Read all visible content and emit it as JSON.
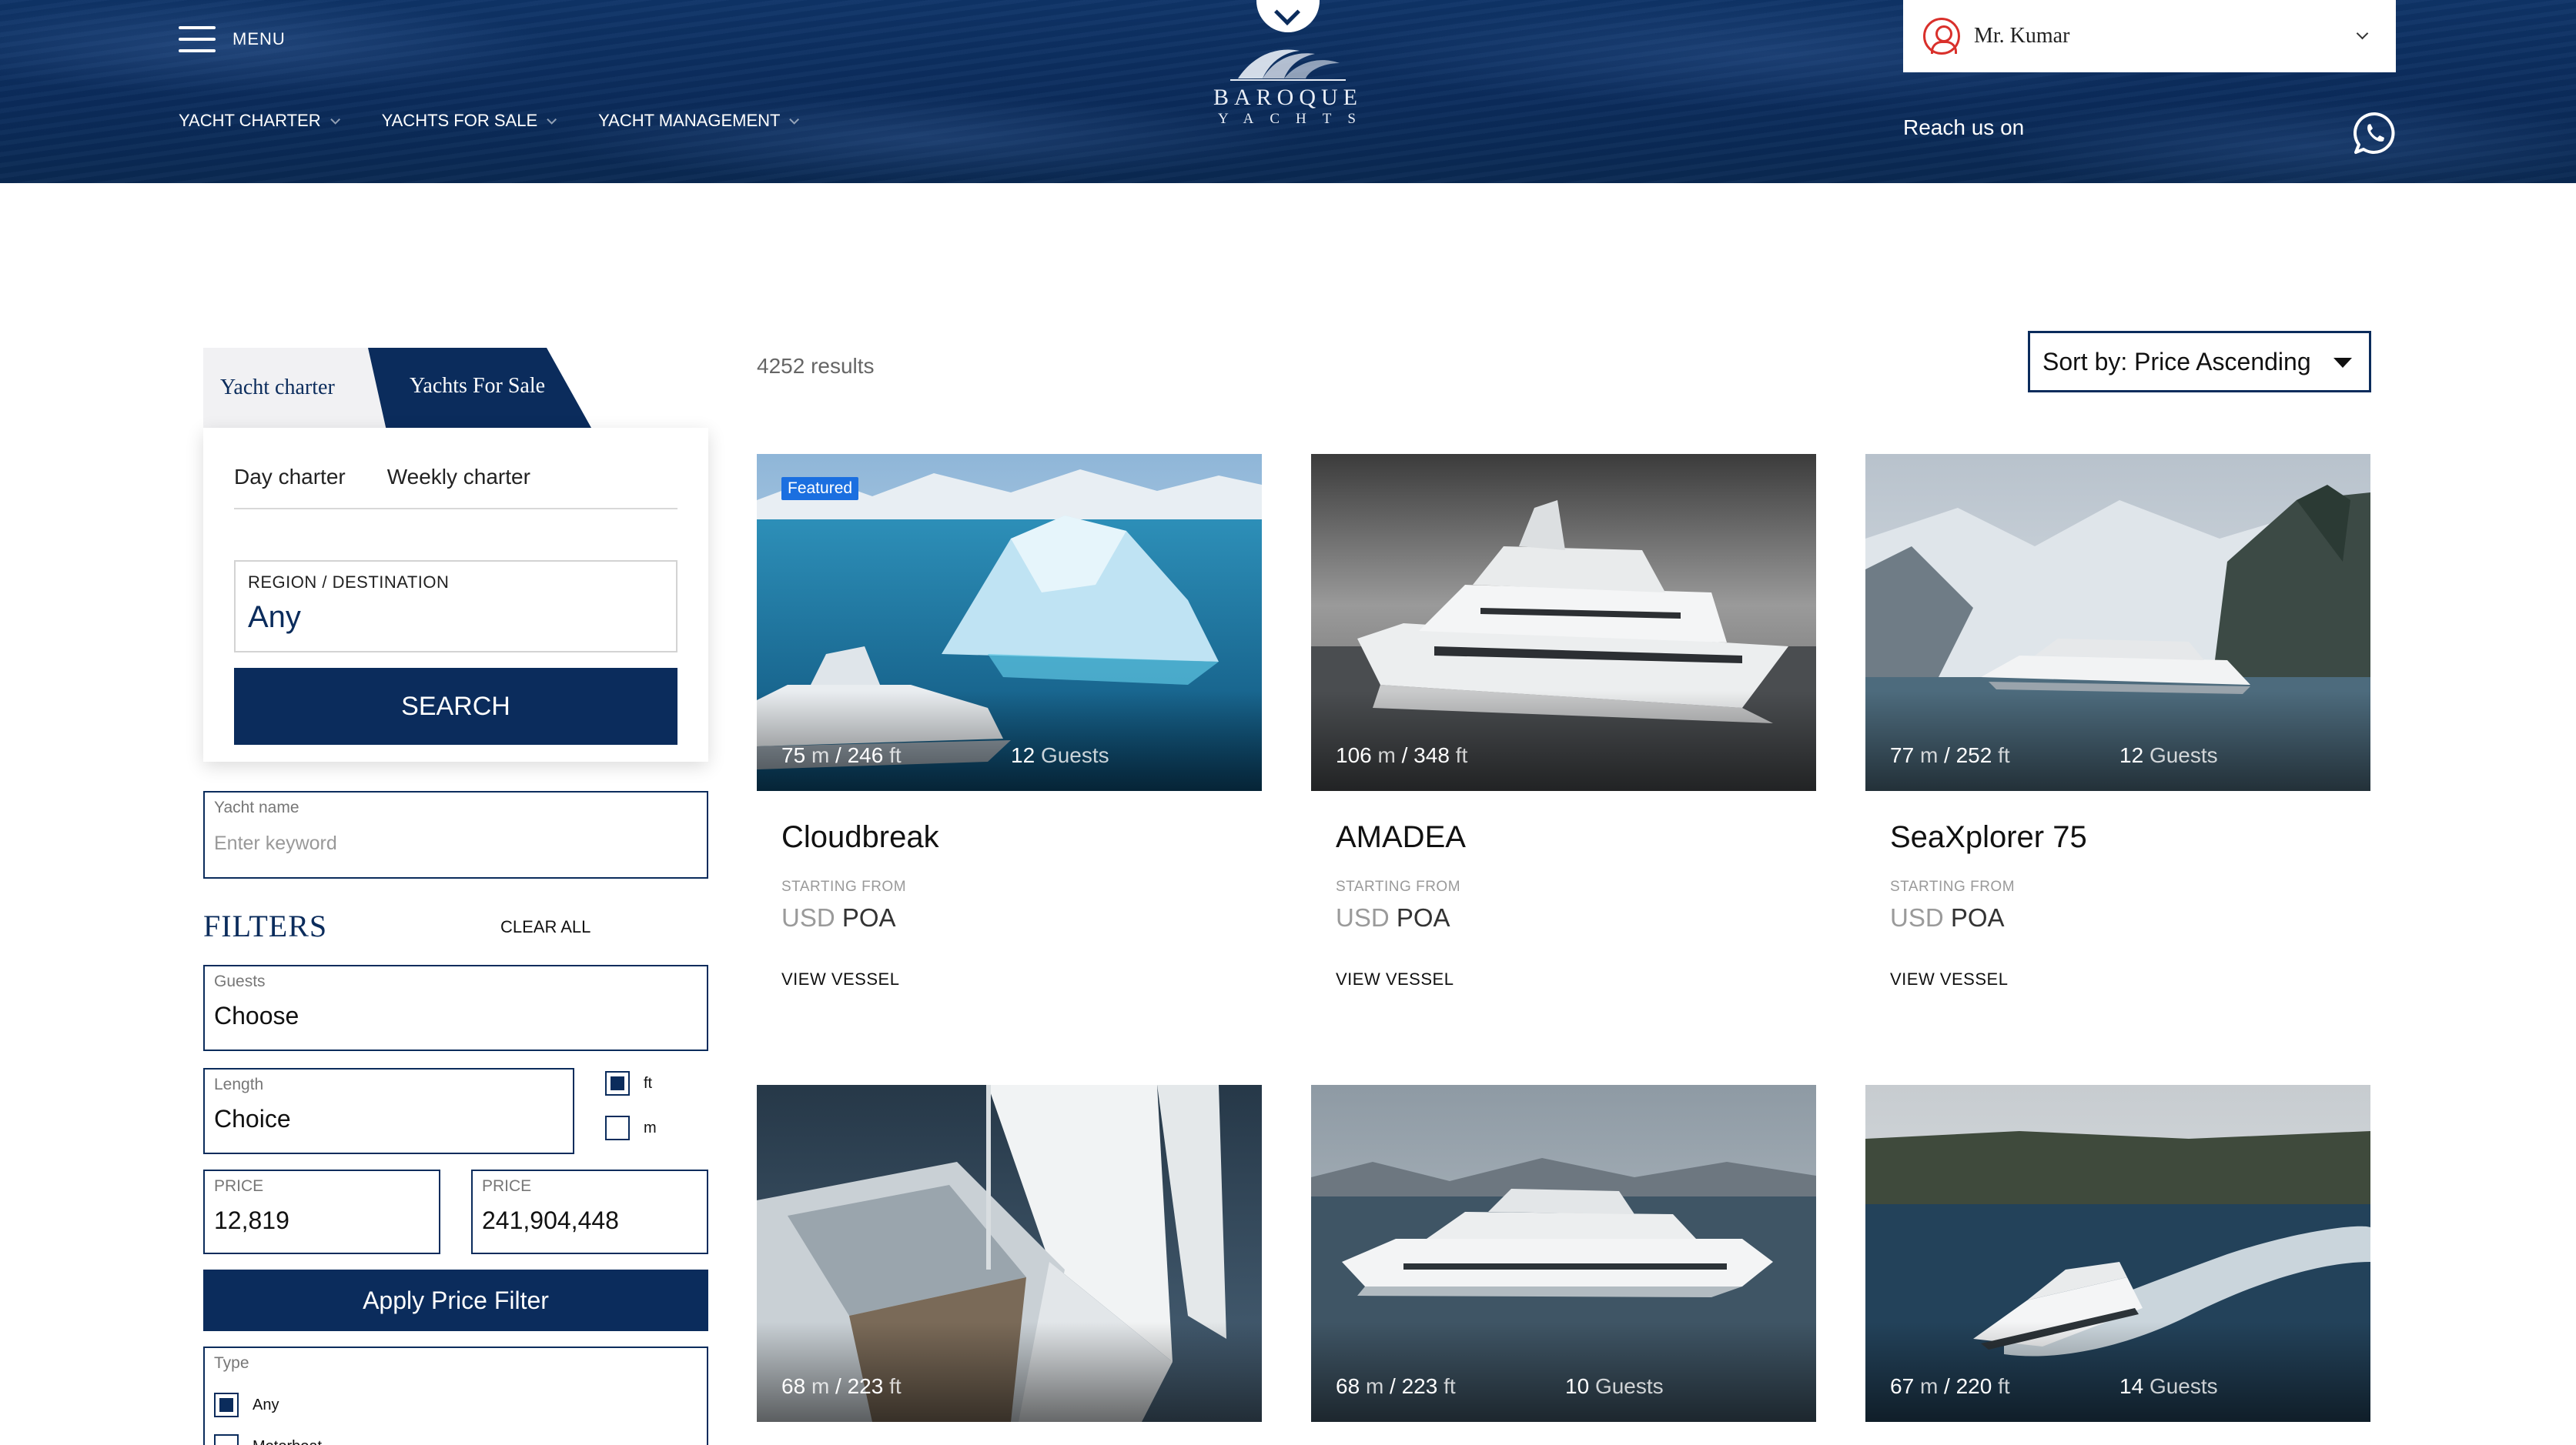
{
  "header": {
    "menu_label": "MENU",
    "nav": [
      {
        "label": "YACHT CHARTER"
      },
      {
        "label": "YACHTS FOR SALE"
      },
      {
        "label": "YACHT MANAGEMENT"
      }
    ],
    "logo": {
      "name": "BAROQUE",
      "sub": "YACHTS"
    },
    "user_name": "Mr. Kumar",
    "reach_label": "Reach us on",
    "colors": {
      "brand": "#0b2c5c",
      "accent_red": "#d9302b",
      "badge_blue": "#1b6fe0"
    }
  },
  "sidebar": {
    "tabs": [
      {
        "label": "Yacht charter",
        "active": false
      },
      {
        "label": "Yachts For Sale",
        "active": true
      }
    ],
    "subtabs": [
      {
        "label": "Day charter"
      },
      {
        "label": "Weekly charter"
      }
    ],
    "region": {
      "label": "REGION / DESTINATION",
      "value": "Any"
    },
    "search_label": "SEARCH",
    "yacht_name": {
      "label": "Yacht name",
      "placeholder": "Enter keyword"
    },
    "filters_title": "FILTERS",
    "clear_all": "CLEAR ALL",
    "guests": {
      "label": "Guests",
      "value": "Choose"
    },
    "length": {
      "label": "Length",
      "value": "Choice"
    },
    "units": [
      {
        "label": "ft",
        "checked": true
      },
      {
        "label": "m",
        "checked": false
      }
    ],
    "price_min": {
      "label": "PRICE",
      "value": "12,819"
    },
    "price_max": {
      "label": "PRICE",
      "value": "241,904,448"
    },
    "apply_label": "Apply Price Filter",
    "type": {
      "label": "Type",
      "options": [
        {
          "label": "Any",
          "checked": true
        },
        {
          "label": "Motorboat",
          "checked": false
        }
      ]
    }
  },
  "results": {
    "count_text": "4252 results",
    "sort_label": "Sort by: Price Ascending",
    "cards": [
      {
        "name": "Cloudbreak",
        "featured": "Featured",
        "len_m": "75",
        "len_ft": "246",
        "guests": "12",
        "from_label": "STARTING FROM",
        "currency": "USD",
        "price": "POA",
        "link": "VIEW VESSEL",
        "scene": "ice"
      },
      {
        "name": "AMADEA",
        "featured": null,
        "len_m": "106",
        "len_ft": "348",
        "guests": null,
        "from_label": "STARTING FROM",
        "currency": "USD",
        "price": "POA",
        "link": "VIEW VESSEL",
        "scene": "grey"
      },
      {
        "name": "SeaXplorer 75",
        "featured": null,
        "len_m": "77",
        "len_ft": "252",
        "guests": "12",
        "from_label": "STARTING FROM",
        "currency": "USD",
        "price": "POA",
        "link": "VIEW VESSEL",
        "scene": "fjord"
      },
      {
        "name": "",
        "featured": null,
        "len_m": "68",
        "len_ft": "223",
        "guests": null,
        "scene": "sail"
      },
      {
        "name": "",
        "featured": null,
        "len_m": "68",
        "len_ft": "223",
        "guests": "10",
        "scene": "coast"
      },
      {
        "name": "",
        "featured": null,
        "len_m": "67",
        "len_ft": "220",
        "guests": "14",
        "scene": "wake"
      }
    ],
    "units": {
      "m": "m",
      "ft": "ft",
      "guests": "Guests"
    }
  }
}
